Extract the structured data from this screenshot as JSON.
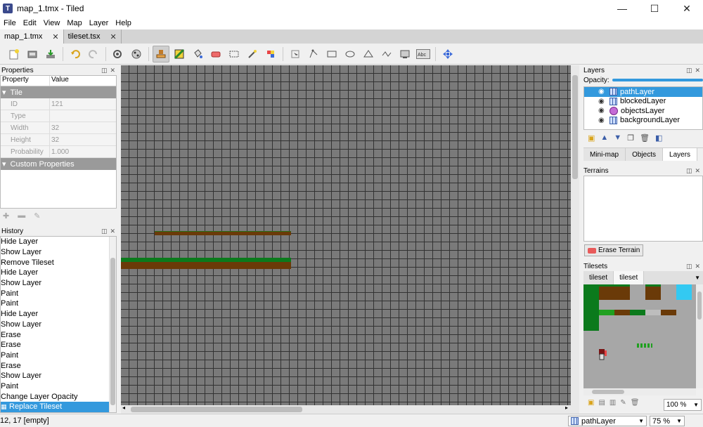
{
  "window": {
    "title": "map_1.tmx - Tiled",
    "logo_letter": "T",
    "minimize": "—",
    "maximize": "☐",
    "close": "✕"
  },
  "menu": {
    "items": [
      {
        "label": "File"
      },
      {
        "label": "Edit"
      },
      {
        "label": "View"
      },
      {
        "label": "Map"
      },
      {
        "label": "Layer"
      },
      {
        "label": "Help"
      }
    ]
  },
  "tabs": [
    {
      "label": "map_1.tmx",
      "close": "✕"
    },
    {
      "label": "tileset.tsx",
      "close": "✕"
    }
  ],
  "properties": {
    "title": "Properties",
    "col_property": "Property",
    "col_value": "Value",
    "group_tile": "Tile",
    "rows": [
      {
        "name": "ID",
        "value": "121"
      },
      {
        "name": "Type",
        "value": ""
      },
      {
        "name": "Width",
        "value": "32"
      },
      {
        "name": "Height",
        "value": "32"
      },
      {
        "name": "Probability",
        "value": "1.000"
      }
    ],
    "group_custom": "Custom Properties"
  },
  "history": {
    "title": "History",
    "items": [
      "Hide Layer",
      "Show Layer",
      "Remove Tileset",
      "Hide Layer",
      "Show Layer",
      "Paint",
      "Paint",
      "Hide Layer",
      "Show Layer",
      "Erase",
      "Erase",
      "Paint",
      "Erase",
      "Show Layer",
      "Paint",
      "Change Layer Opacity",
      "Replace Tileset"
    ]
  },
  "layers": {
    "title": "Layers",
    "opacity_label": "Opacity:",
    "opacity": 1.0,
    "items": [
      {
        "name": "pathLayer"
      },
      {
        "name": "blockedLayer"
      },
      {
        "name": "objectsLayer"
      },
      {
        "name": "backgroundLayer"
      }
    ],
    "tabs": [
      {
        "label": "Mini-map"
      },
      {
        "label": "Objects"
      },
      {
        "label": "Layers"
      }
    ]
  },
  "terrains": {
    "title": "Terrains",
    "erase_label": "Erase Terrain"
  },
  "tilesets": {
    "title": "Tilesets",
    "tabs": [
      {
        "label": "tileset"
      },
      {
        "label": "tileset"
      }
    ],
    "zoom": "100 %"
  },
  "status": {
    "coords": "12, 17 [empty]",
    "current_layer": "pathLayer",
    "zoom": "75 %"
  },
  "colors": {
    "selection": "#3399dd",
    "grass": "#0b7a1c",
    "dirt": "#6a3a08",
    "water": "#33c9f2"
  }
}
